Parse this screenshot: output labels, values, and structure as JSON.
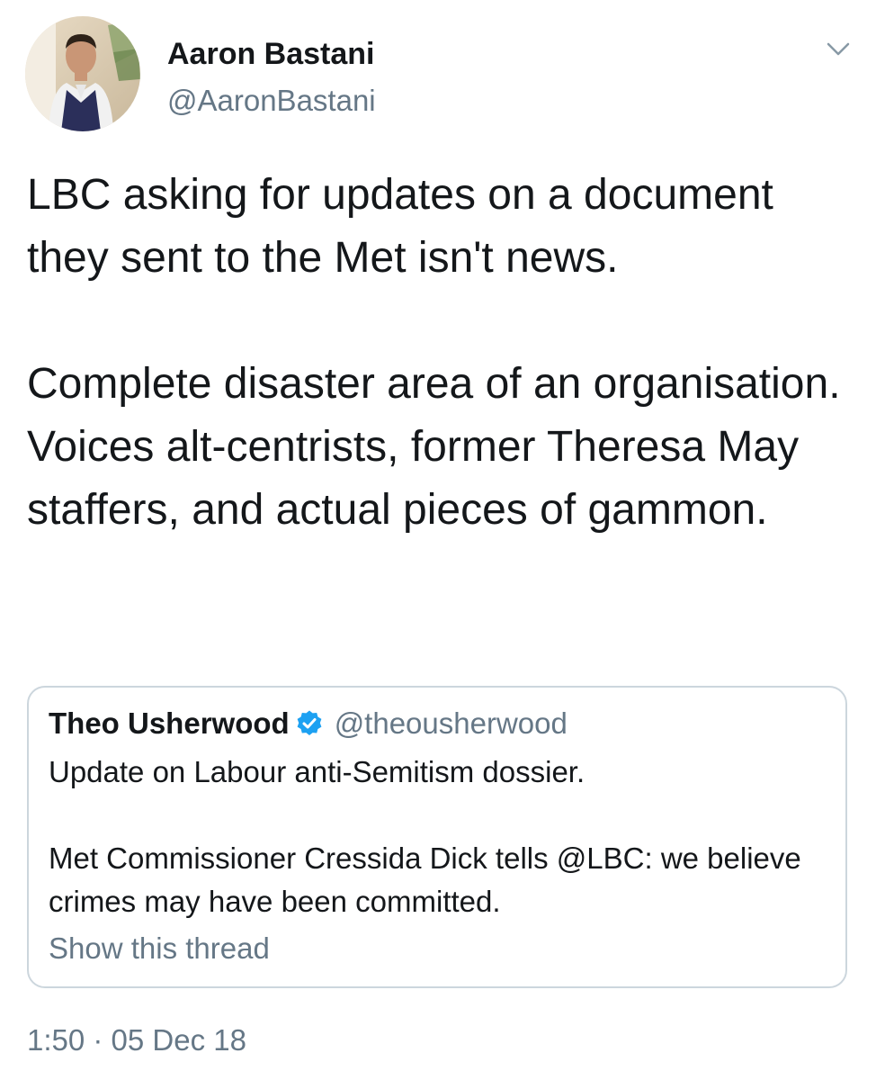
{
  "author": {
    "display_name": "Aaron Bastani",
    "handle": "@AaronBastani",
    "avatar_icon": "user-avatar-photo"
  },
  "tweet": {
    "paragraphs": [
      "LBC asking for updates on a document they sent to the Met isn't news.",
      "Complete disaster area of an organisation. Voices alt-centrists, former Theresa May staffers, and actual pieces of gammon."
    ],
    "timestamp": "1:50 · 05 Dec 18"
  },
  "quoted_tweet": {
    "display_name": "Theo Usherwood",
    "verified_icon": "verified-badge-icon",
    "handle": "@theousherwood",
    "paragraphs": [
      "Update on Labour anti-Semitism dossier.",
      "Met Commissioner Cressida Dick tells @LBC: we believe crimes may have been committed."
    ],
    "show_thread_label": "Show this thread"
  },
  "colors": {
    "text_primary": "#14171a",
    "text_secondary": "#657786",
    "border": "#ccd6dd",
    "verified_blue": "#1da1f2"
  }
}
